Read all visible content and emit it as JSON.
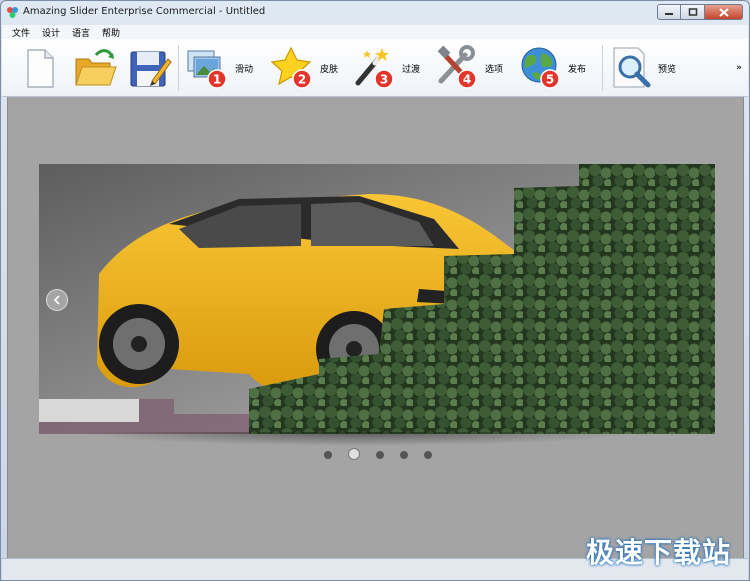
{
  "window": {
    "title": "Amazing Slider Enterprise Commercial - Untitled"
  },
  "menu": [
    "文件",
    "设计",
    "语言",
    "帮助"
  ],
  "toolbar": {
    "buttons": [
      {
        "icon": "new-document-icon",
        "label": ""
      },
      {
        "icon": "open-folder-icon",
        "label": ""
      },
      {
        "icon": "save-icon",
        "label": ""
      },
      {
        "icon": "slides-icon",
        "label": "滑动",
        "step": "1"
      },
      {
        "icon": "skin-star-icon",
        "label": "皮肤",
        "step": "2"
      },
      {
        "icon": "transition-wand-icon",
        "label": "过渡",
        "step": "3"
      },
      {
        "icon": "options-tools-icon",
        "label": "选项",
        "step": "4"
      },
      {
        "icon": "publish-globe-icon",
        "label": "发布",
        "step": "5"
      },
      {
        "icon": "preview-magnifier-icon",
        "label": "预览"
      }
    ],
    "more": "»"
  },
  "slider": {
    "slide_count": 5,
    "active_index": 1
  },
  "watermark": "极速下载站",
  "colors": {
    "step_badge": "#e4352a",
    "canvas_bg": "#a4a4a4",
    "car_yellow": "#f2b417",
    "forest_green": "#2f4a2c"
  }
}
